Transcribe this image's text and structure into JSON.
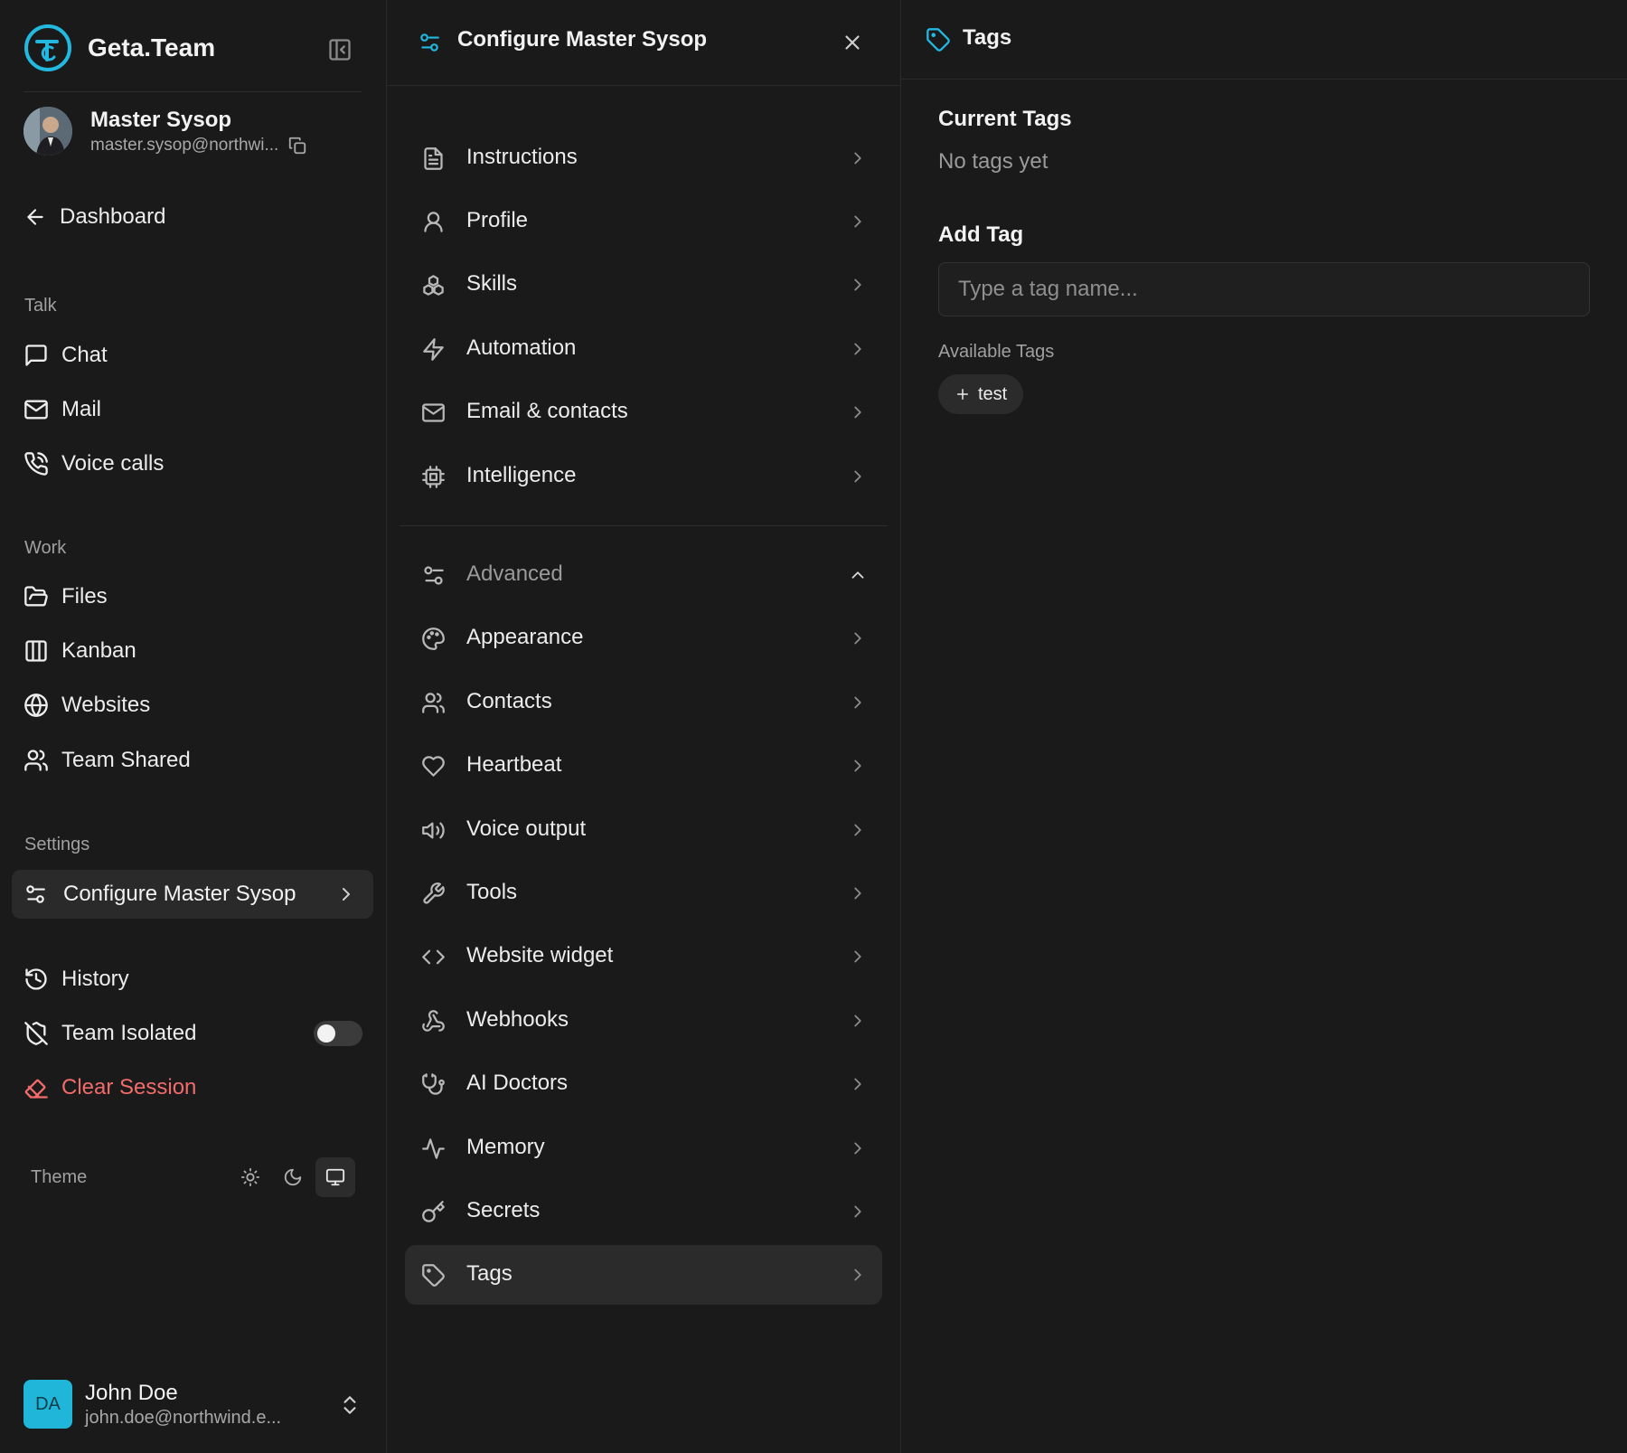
{
  "brand": {
    "name": "Geta.Team"
  },
  "user": {
    "name": "Master Sysop",
    "email": "master.sysop@northwi..."
  },
  "sidebar": {
    "back_label": "Dashboard",
    "talk_label": "Talk",
    "talk_items": [
      "Chat",
      "Mail",
      "Voice calls"
    ],
    "work_label": "Work",
    "work_items": [
      "Files",
      "Kanban",
      "Websites",
      "Team Shared"
    ],
    "settings_label": "Settings",
    "active_item": "Configure Master Sysop",
    "history_label": "History",
    "team_isolated_label": "Team Isolated",
    "team_isolated_on": false,
    "clear_session_label": "Clear Session",
    "theme_label": "Theme",
    "theme_selected": "system"
  },
  "account": {
    "initials": "DA",
    "name": "John Doe",
    "email": "john.doe@northwind.e..."
  },
  "config": {
    "title": "Configure Master Sysop",
    "items": [
      "Instructions",
      "Profile",
      "Skills",
      "Automation",
      "Email & contacts",
      "Intelligence"
    ],
    "advanced_label": "Advanced",
    "advanced_items": [
      "Appearance",
      "Contacts",
      "Heartbeat",
      "Voice output",
      "Tools",
      "Website widget",
      "Webhooks",
      "AI Doctors",
      "Memory",
      "Secrets",
      "Tags"
    ]
  },
  "tags": {
    "title": "Tags",
    "current_heading": "Current Tags",
    "empty_text": "No tags yet",
    "add_heading": "Add Tag",
    "input_placeholder": "Type a tag name...",
    "input_value": "",
    "available_label": "Available Tags",
    "available": [
      "test"
    ]
  },
  "colors": {
    "accent": "#22b8e0",
    "danger": "#f26b6b",
    "background": "#1a1a1a"
  }
}
